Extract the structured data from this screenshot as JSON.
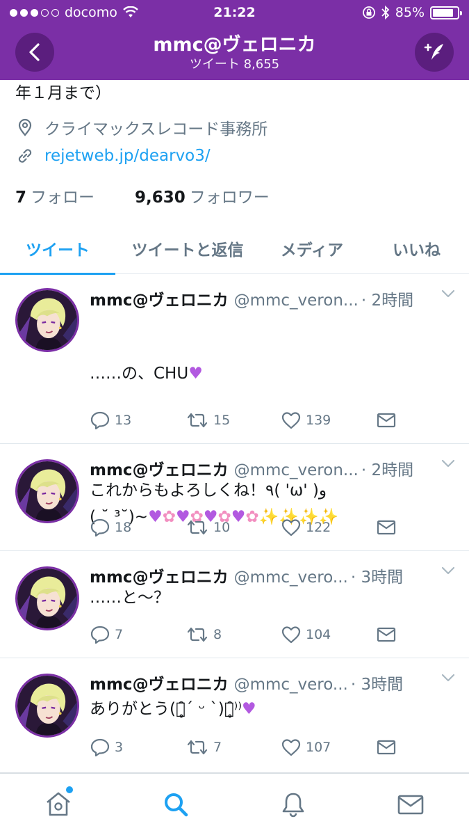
{
  "status_bar": {
    "carrier": "docomo",
    "time": "21:22",
    "battery": "85%",
    "battery_level": 0.85
  },
  "header": {
    "title": "mmc@ヴェロニカ",
    "subtitle": "ツイート 8,655"
  },
  "profile": {
    "bio_fragment": "年１月まで）",
    "location": "クライマックスレコード事務所",
    "link": "rejetweb.jp/dearvo3/",
    "following_count": "7",
    "following_label": "フォロー",
    "followers_count": "9,630",
    "followers_label": "フォロワー"
  },
  "tabs": [
    {
      "label": "ツイート",
      "active": true
    },
    {
      "label": "ツイートと返信",
      "active": false
    },
    {
      "label": "メディア",
      "active": false
    },
    {
      "label": "いいね",
      "active": false
    }
  ],
  "tweets": [
    {
      "name": "mmc@ヴェロニカ",
      "handle": "@mmc_veron...",
      "time": "· 2時間",
      "text_line1": "……の、CHU",
      "text_line3": "( ˘ ³˘)~",
      "replies": "13",
      "retweets": "15",
      "likes": "139"
    },
    {
      "name": "mmc@ヴェロニカ",
      "handle": "@mmc_veron...",
      "time": "· 2時間",
      "text": "これからもよろしくね！٩( 'ω' )و",
      "replies": "18",
      "retweets": "10",
      "likes": "122"
    },
    {
      "name": "mmc@ヴェロニカ",
      "handle": "@mmc_vero...",
      "time": "· 3時間",
      "text": "……と〜？",
      "replies": "7",
      "retweets": "8",
      "likes": "104"
    },
    {
      "name": "mmc@ヴェロニカ",
      "handle": "@mmc_vero...",
      "time": "· 3時間",
      "text": "ありがとう(ว̥̑ˊ ᵕ ˋ)ว̥̑⁾⁾",
      "replies": "3",
      "retweets": "7",
      "likes": "107"
    }
  ],
  "colors": {
    "header_purple": "#7b2fa6",
    "accent_blue": "#1da1f2",
    "muted": "#657786"
  },
  "icons": [
    "back-icon",
    "compose-icon",
    "location-icon",
    "link-icon",
    "reply-icon",
    "retweet-icon",
    "like-icon",
    "dm-icon",
    "home-icon",
    "search-icon",
    "notifications-icon",
    "messages-icon"
  ]
}
